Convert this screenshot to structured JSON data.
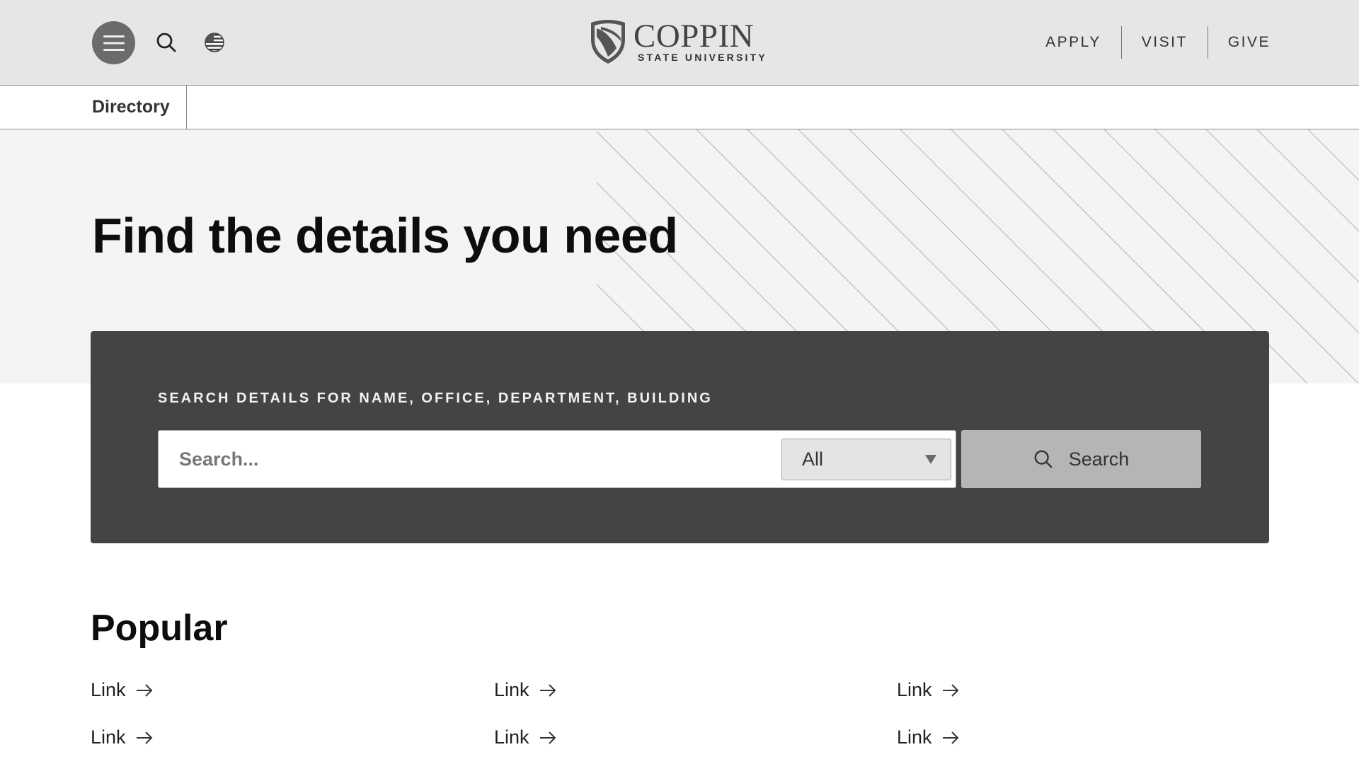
{
  "header": {
    "menu_icon": "hamburger-menu-icon",
    "search_icon": "search-icon",
    "language_icon": "globe-flag-icon",
    "logo": {
      "main": "COPPIN",
      "sub": "STATE UNIVERSITY",
      "icon": "shield-icon"
    },
    "nav": [
      {
        "label": "APPLY"
      },
      {
        "label": "VISIT"
      },
      {
        "label": "GIVE"
      }
    ]
  },
  "subnav": {
    "item": "Directory"
  },
  "hero": {
    "title": "Find the details you need"
  },
  "search": {
    "label": "SEARCH DETAILS FOR NAME, OFFICE, DEPARTMENT, BUILDING",
    "placeholder": "Search...",
    "scope_selected": "All",
    "submit_label": "Search"
  },
  "popular": {
    "title": "Popular",
    "links": [
      {
        "label": "Link"
      },
      {
        "label": "Link"
      },
      {
        "label": "Link"
      },
      {
        "label": "Link"
      },
      {
        "label": "Link"
      },
      {
        "label": "Link"
      }
    ]
  },
  "colors": {
    "header_bg": "#e6e6e6",
    "hero_bg": "#f4f4f4",
    "panel_bg": "#444444",
    "button_bg": "#b5b5b5"
  }
}
